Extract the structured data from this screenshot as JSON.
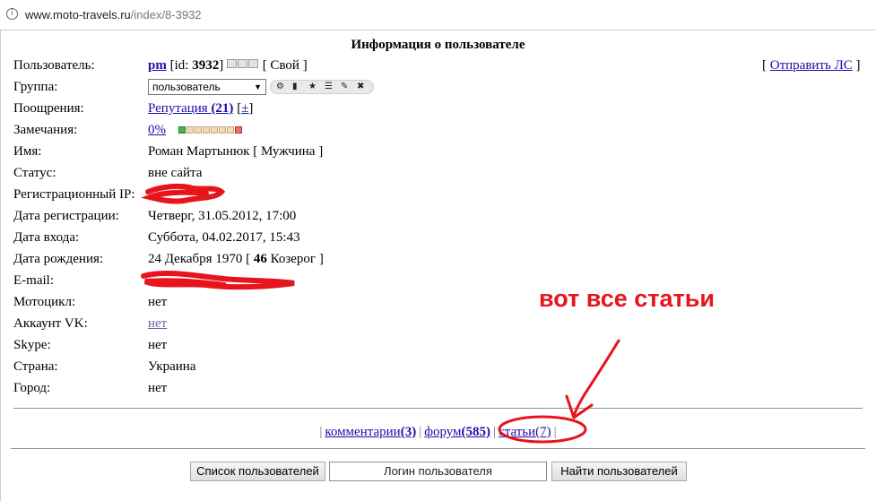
{
  "browser": {
    "url_host": "www.moto-travels.ru",
    "url_path": "/index/8-3932",
    "info_icon": "info-icon"
  },
  "page": {
    "title": "Информация о пользователе",
    "send_pm": "Отправить ЛС"
  },
  "fields": {
    "user": {
      "label": "Пользователь:",
      "name": "pm",
      "id_prefix": "[id: ",
      "id": "3932",
      "id_suffix": "]",
      "own": "[ Свой ]"
    },
    "group": {
      "label": "Группа:",
      "selected": "пользователь"
    },
    "rewards": {
      "label": "Поощрения:",
      "reputation_text": "Репутация",
      "reputation_count": "(21)",
      "plusminus": "±"
    },
    "warnings": {
      "label": "Замечания:",
      "value": "0%"
    },
    "name": {
      "label": "Имя:",
      "value": "Роман Мартынюк [ Мужчина ]"
    },
    "status": {
      "label": "Статус:",
      "value": "вне сайта"
    },
    "reg_ip": {
      "label": "Регистрационный IP:"
    },
    "reg_date": {
      "label": "Дата регистрации:",
      "value": "Четверг, 31.05.2012, 17:00"
    },
    "login_date": {
      "label": "Дата входа:",
      "value": "Суббота, 04.02.2017, 15:43"
    },
    "birthday": {
      "label": "Дата рождения:",
      "date": "24 Декабря 1970",
      "age": "46",
      "sign": "Козерог"
    },
    "email": {
      "label": "E-mail:"
    },
    "motorcycle": {
      "label": "Мотоцикл:",
      "value": "нет"
    },
    "vk": {
      "label": "Аккаунт VK:",
      "value": "нет"
    },
    "skype": {
      "label": "Skype:",
      "value": "нет"
    },
    "country": {
      "label": "Страна:",
      "value": "Украина"
    },
    "city": {
      "label": "Город:",
      "value": "нет"
    }
  },
  "tabs": [
    {
      "label": "комментарии",
      "count": "(3)"
    },
    {
      "label": "форум",
      "count": "(585)"
    },
    {
      "label": "статьи",
      "count": "(7)"
    }
  ],
  "bottom": {
    "users_list_button": "Список пользователей",
    "login_placeholder": "Логин пользователя",
    "find_button": "Найти пользователей"
  },
  "annotation": {
    "text": "вот все статьи",
    "color": "#e8141b"
  },
  "colors": {
    "link": "#1a0dab",
    "visited": "#666699",
    "red_marker": "#e8141b"
  }
}
